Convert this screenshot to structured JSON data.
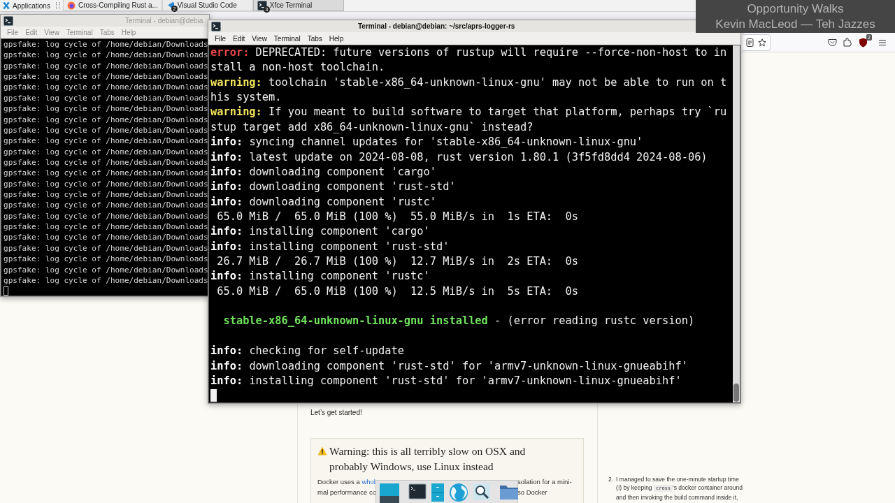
{
  "taskbar": {
    "menu_label": "Applications",
    "tasks": [
      {
        "kind": "browser",
        "label": "Cross-Compiling Rust a...",
        "selected": false
      },
      {
        "kind": "editor",
        "label": "Visual Studio Code",
        "badge": "2",
        "selected": false
      },
      {
        "kind": "terminal",
        "label": "Xfce Terminal",
        "badge": "3",
        "selected": true
      }
    ]
  },
  "now_playing": {
    "title": "Opportunity Walks",
    "artist": "Kevin MacLeod — Teh Jazzes"
  },
  "browser": {
    "toolbar": {
      "shield_badge": "2"
    },
    "page": {
      "intro": "Let’s get started!",
      "warning": {
        "title": "Warning: this is all terribly slow on OSX and probably Windows, use Linux instead",
        "left": [
          {
            "text": "Docker uses a ",
            "link": "whol"
          },
          {
            "text": "mal performance co"
          }
        ],
        "right": [
          "solation for a mini-",
          "so Docker"
        ]
      },
      "side_note": {
        "number": "2.",
        "before": "I managed to save the one-minute startup time (!) by keeping ",
        "code": "cross",
        "after": "'s docker container around and then invoking the build command inside it,"
      }
    }
  },
  "terminals": [
    {
      "title": "Terminal - debian@debia",
      "active": false,
      "menu": [
        "File",
        "Edit",
        "View",
        "Terminal",
        "Tabs",
        "Help"
      ],
      "lines": [
        {
          "kind": "plain",
          "text": "gpsfake: log cycle of /home/debian/Downloads"
        },
        {
          "kind": "plain",
          "text": "gpsfake: log cycle of /home/debian/Downloads"
        },
        {
          "kind": "plain",
          "text": "gpsfake: log cycle of /home/debian/Downloads"
        },
        {
          "kind": "plain",
          "text": "gpsfake: log cycle of /home/debian/Downloads"
        },
        {
          "kind": "plain",
          "text": "gpsfake: log cycle of /home/debian/Downloads"
        },
        {
          "kind": "plain",
          "text": "gpsfake: log cycle of /home/debian/Downloads"
        },
        {
          "kind": "plain",
          "text": "gpsfake: log cycle of /home/debian/Downloads"
        },
        {
          "kind": "plain",
          "text": "gpsfake: log cycle of /home/debian/Downloads"
        },
        {
          "kind": "plain",
          "text": "gpsfake: log cycle of /home/debian/Downloads"
        },
        {
          "kind": "plain",
          "text": "gpsfake: log cycle of /home/debian/Downloads"
        },
        {
          "kind": "plain",
          "text": "gpsfake: log cycle of /home/debian/Downloads"
        },
        {
          "kind": "plain",
          "text": "gpsfake: log cycle of /home/debian/Downloads"
        },
        {
          "kind": "plain",
          "text": "gpsfake: log cycle of /home/debian/Downloads"
        },
        {
          "kind": "plain",
          "text": "gpsfake: log cycle of /home/debian/Downloads"
        },
        {
          "kind": "plain",
          "text": "gpsfake: log cycle of /home/debian/Downloads"
        },
        {
          "kind": "plain",
          "text": "gpsfake: log cycle of /home/debian/Downloads"
        },
        {
          "kind": "plain",
          "text": "gpsfake: log cycle of /home/debian/Downloads"
        },
        {
          "kind": "plain",
          "text": "gpsfake: log cycle of /home/debian/Downloads"
        },
        {
          "kind": "plain",
          "text": "gpsfake: log cycle of /home/debian/Downloads"
        },
        {
          "kind": "plain",
          "text": "gpsfake: log cycle of /home/debian/Downloads"
        },
        {
          "kind": "plain",
          "text": "gpsfake: log cycle of /home/debian/Downloads"
        },
        {
          "kind": "plain",
          "text": "gpsfake: log cycle of /home/debian/Downloads"
        },
        {
          "kind": "plain",
          "text": "gpsfake: log cycle of /home/debian/Downloads"
        }
      ]
    },
    {
      "title": "Terminal - debian@debian: ~/src/aprs-logger-rs",
      "active": true,
      "menu": [
        "File",
        "Edit",
        "View",
        "Terminal",
        "Tabs",
        "Help"
      ],
      "lines": [
        {
          "kind": "error",
          "tag": "error:",
          "text": " DEPRECATED: future versions of rustup will require --force-non-host to in"
        },
        {
          "kind": "plain",
          "text": "stall a non-host toolchain."
        },
        {
          "kind": "warning",
          "tag": "warning:",
          "text": " toolchain 'stable-x86_64-unknown-linux-gnu' may not be able to run on t"
        },
        {
          "kind": "plain",
          "text": "his system."
        },
        {
          "kind": "warning",
          "tag": "warning:",
          "text": " If you meant to build software to target that platform, perhaps try `ru"
        },
        {
          "kind": "plain",
          "text": "stup target add x86_64-unknown-linux-gnu` instead?"
        },
        {
          "kind": "info",
          "tag": "info:",
          "text": " syncing channel updates for 'stable-x86_64-unknown-linux-gnu'"
        },
        {
          "kind": "info",
          "tag": "info:",
          "text": " latest update on 2024-08-08, rust version 1.80.1 (3f5fd8dd4 2024-08-06)"
        },
        {
          "kind": "info",
          "tag": "info:",
          "text": " downloading component 'cargo'"
        },
        {
          "kind": "info",
          "tag": "info:",
          "text": " downloading component 'rust-std'"
        },
        {
          "kind": "info",
          "tag": "info:",
          "text": " downloading component 'rustc'"
        },
        {
          "kind": "plain",
          "text": " 65.0 MiB /  65.0 MiB (100 %)  55.0 MiB/s in  1s ETA:  0s"
        },
        {
          "kind": "info",
          "tag": "info:",
          "text": " installing component 'cargo'"
        },
        {
          "kind": "info",
          "tag": "info:",
          "text": " installing component 'rust-std'"
        },
        {
          "kind": "plain",
          "text": " 26.7 MiB /  26.7 MiB (100 %)  12.7 MiB/s in  2s ETA:  0s"
        },
        {
          "kind": "info",
          "tag": "info:",
          "text": " installing component 'rustc'"
        },
        {
          "kind": "plain",
          "text": " 65.0 MiB /  65.0 MiB (100 %)  12.5 MiB/s in  5s ETA:  0s"
        },
        {
          "kind": "blank"
        },
        {
          "kind": "installed",
          "tag": "stable-x86_64-unknown-linux-gnu installed",
          "text": " - (error reading rustc version)"
        },
        {
          "kind": "blank"
        },
        {
          "kind": "info",
          "tag": "info:",
          "text": " checking for self-update"
        },
        {
          "kind": "info",
          "tag": "info:",
          "text": " downloading component 'rust-std' for 'armv7-unknown-linux-gnueabihf'"
        },
        {
          "kind": "info",
          "tag": "info:",
          "text": " installing component 'rust-std' for 'armv7-unknown-linux-gnueabihf'"
        }
      ]
    }
  ]
}
